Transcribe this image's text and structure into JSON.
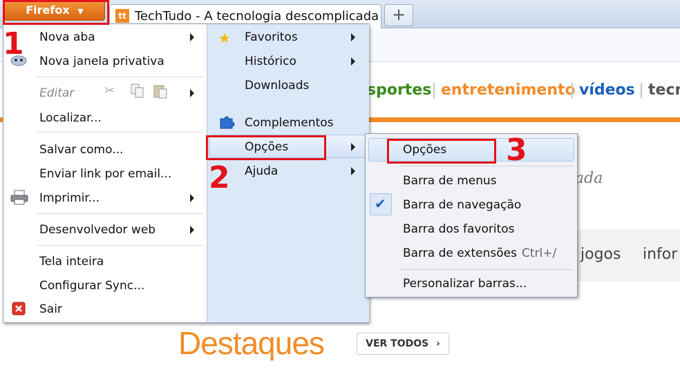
{
  "browser": {
    "menu_button": "Firefox",
    "tab_title": "TechTudo - A tecnologia descomplicada",
    "tab_icon_text": "tt",
    "new_tab_symbol": "+"
  },
  "page": {
    "nav_items": [
      {
        "label": "sportes",
        "color": "#3b8a1f"
      },
      {
        "label": "entretenimento",
        "color": "#f28c28"
      },
      {
        "label": "vídeos",
        "color": "#1b5fbf"
      },
      {
        "label": "tecn",
        "color": "#555555"
      }
    ],
    "tagline_fragment": "ada",
    "menu_fragments": [
      "jogos",
      "infor"
    ],
    "section_title": "Destaques",
    "see_all_button": "VER TODOS"
  },
  "menu": {
    "left": [
      {
        "label": "Nova aba",
        "submenu": true
      },
      {
        "label": "Nova janela privativa",
        "submenu": false
      },
      {
        "label": "Editar",
        "submenu": true
      },
      {
        "label": "Localizar...",
        "submenu": false
      },
      {
        "label": "Salvar como...",
        "submenu": false
      },
      {
        "label": "Enviar link por email...",
        "submenu": false
      },
      {
        "label": "Imprimir...",
        "submenu": true
      },
      {
        "label": "Desenvolvedor web",
        "submenu": true
      },
      {
        "label": "Tela inteira",
        "submenu": false
      },
      {
        "label": "Configurar Sync...",
        "submenu": false
      },
      {
        "label": "Sair",
        "submenu": false
      }
    ],
    "right": [
      {
        "label": "Favoritos",
        "submenu": true
      },
      {
        "label": "Histórico",
        "submenu": true
      },
      {
        "label": "Downloads",
        "submenu": false
      },
      {
        "label": "Complementos",
        "submenu": false
      },
      {
        "label": "Opções",
        "submenu": true
      },
      {
        "label": "Ajuda",
        "submenu": true
      }
    ]
  },
  "submenu": {
    "items": [
      {
        "label": "Opções",
        "checked": false
      },
      {
        "label": "Barra de menus",
        "checked": false
      },
      {
        "label": "Barra de navegação",
        "checked": true
      },
      {
        "label": "Barra dos favoritos",
        "checked": false
      },
      {
        "label": "Barra de extensões",
        "shortcut": "Ctrl+/",
        "checked": false
      },
      {
        "label": "Personalizar barras...",
        "checked": false
      }
    ]
  },
  "annotations": [
    "1",
    "2",
    "3"
  ],
  "colors": {
    "annotation_red": "#e3131b",
    "firefox_orange": "#e8741c",
    "checkmark_blue": "#1f5fbf"
  }
}
